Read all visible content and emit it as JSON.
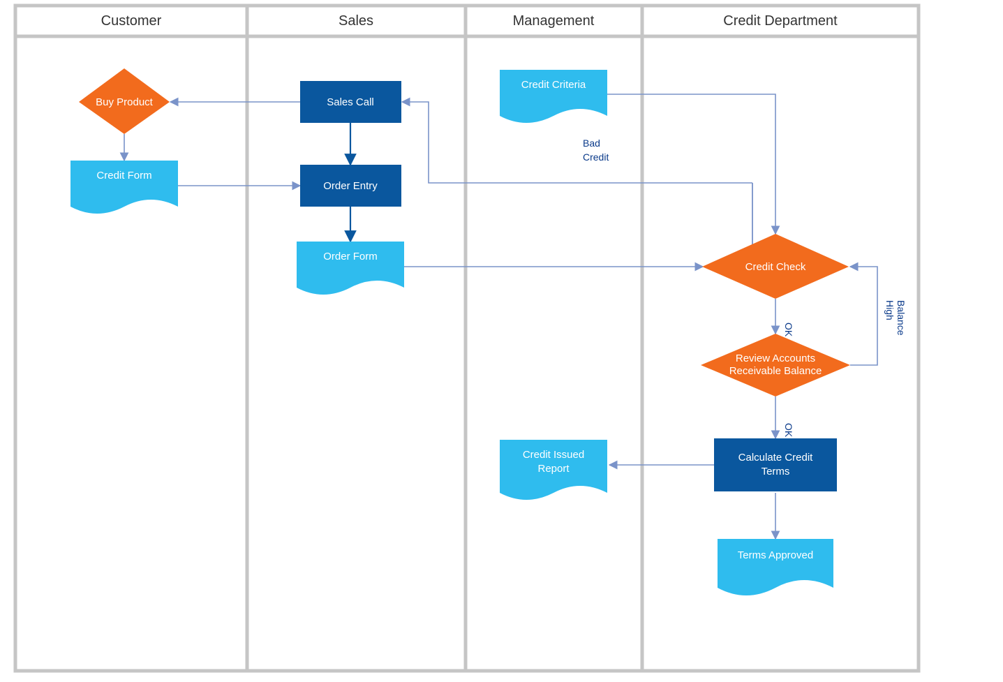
{
  "lanes": {
    "customer": "Customer",
    "sales": "Sales",
    "management": "Management",
    "credit_dept": "Credit Department"
  },
  "nodes": {
    "buy_product": "Buy Product",
    "credit_form": "Credit Form",
    "sales_call": "Sales Call",
    "order_entry": "Order Entry",
    "order_form": "Order Form",
    "credit_criteria": "Credit Criteria",
    "credit_issued_report_l1": "Credit Issued",
    "credit_issued_report_l2": "Report",
    "credit_check": "Credit Check",
    "review_l1": "Review Accounts",
    "review_l2": "Receivable Balance",
    "calc_l1": "Calculate Credit",
    "calc_l2": "Terms",
    "terms_approved": "Terms Approved"
  },
  "edges": {
    "bad_credit_l1": "Bad",
    "bad_credit_l2": "Credit",
    "ok1": "OK",
    "ok2": "OK",
    "high_l1": "High",
    "high_l2": "Balance"
  },
  "colors": {
    "orange": "#F26B1D",
    "blue_dark": "#0A579E",
    "blue_light": "#2FBCEE",
    "lane_border": "#C5C5C5",
    "arrow": "#7A93C9"
  },
  "chart_data": {
    "type": "swimlane-flowchart",
    "lanes": [
      "Customer",
      "Sales",
      "Management",
      "Credit Department"
    ],
    "nodes": [
      {
        "id": "buy_product",
        "lane": "Customer",
        "type": "decision",
        "label": "Buy Product"
      },
      {
        "id": "credit_form",
        "lane": "Customer",
        "type": "document",
        "label": "Credit Form"
      },
      {
        "id": "sales_call",
        "lane": "Sales",
        "type": "process",
        "label": "Sales Call"
      },
      {
        "id": "order_entry",
        "lane": "Sales",
        "type": "process",
        "label": "Order Entry"
      },
      {
        "id": "order_form",
        "lane": "Sales",
        "type": "document",
        "label": "Order Form"
      },
      {
        "id": "credit_criteria",
        "lane": "Management",
        "type": "document",
        "label": "Credit Criteria"
      },
      {
        "id": "credit_issued_report",
        "lane": "Management",
        "type": "document",
        "label": "Credit Issued Report"
      },
      {
        "id": "credit_check",
        "lane": "Credit Department",
        "type": "decision",
        "label": "Credit Check"
      },
      {
        "id": "review_ar_balance",
        "lane": "Credit Department",
        "type": "decision",
        "label": "Review Accounts Receivable Balance"
      },
      {
        "id": "calc_credit_terms",
        "lane": "Credit Department",
        "type": "process",
        "label": "Calculate Credit Terms"
      },
      {
        "id": "terms_approved",
        "lane": "Credit Department",
        "type": "document",
        "label": "Terms Approved"
      }
    ],
    "edges": [
      {
        "from": "sales_call",
        "to": "buy_product"
      },
      {
        "from": "buy_product",
        "to": "credit_form"
      },
      {
        "from": "credit_form",
        "to": "order_entry"
      },
      {
        "from": "sales_call",
        "to": "order_entry"
      },
      {
        "from": "order_entry",
        "to": "order_form"
      },
      {
        "from": "order_form",
        "to": "credit_check"
      },
      {
        "from": "credit_criteria",
        "to": "credit_check"
      },
      {
        "from": "credit_check",
        "to": "sales_call",
        "label": "Bad Credit"
      },
      {
        "from": "credit_check",
        "to": "review_ar_balance",
        "label": "OK"
      },
      {
        "from": "review_ar_balance",
        "to": "credit_check",
        "label": "High Balance"
      },
      {
        "from": "review_ar_balance",
        "to": "calc_credit_terms",
        "label": "OK"
      },
      {
        "from": "calc_credit_terms",
        "to": "credit_issued_report"
      },
      {
        "from": "calc_credit_terms",
        "to": "terms_approved"
      }
    ]
  }
}
